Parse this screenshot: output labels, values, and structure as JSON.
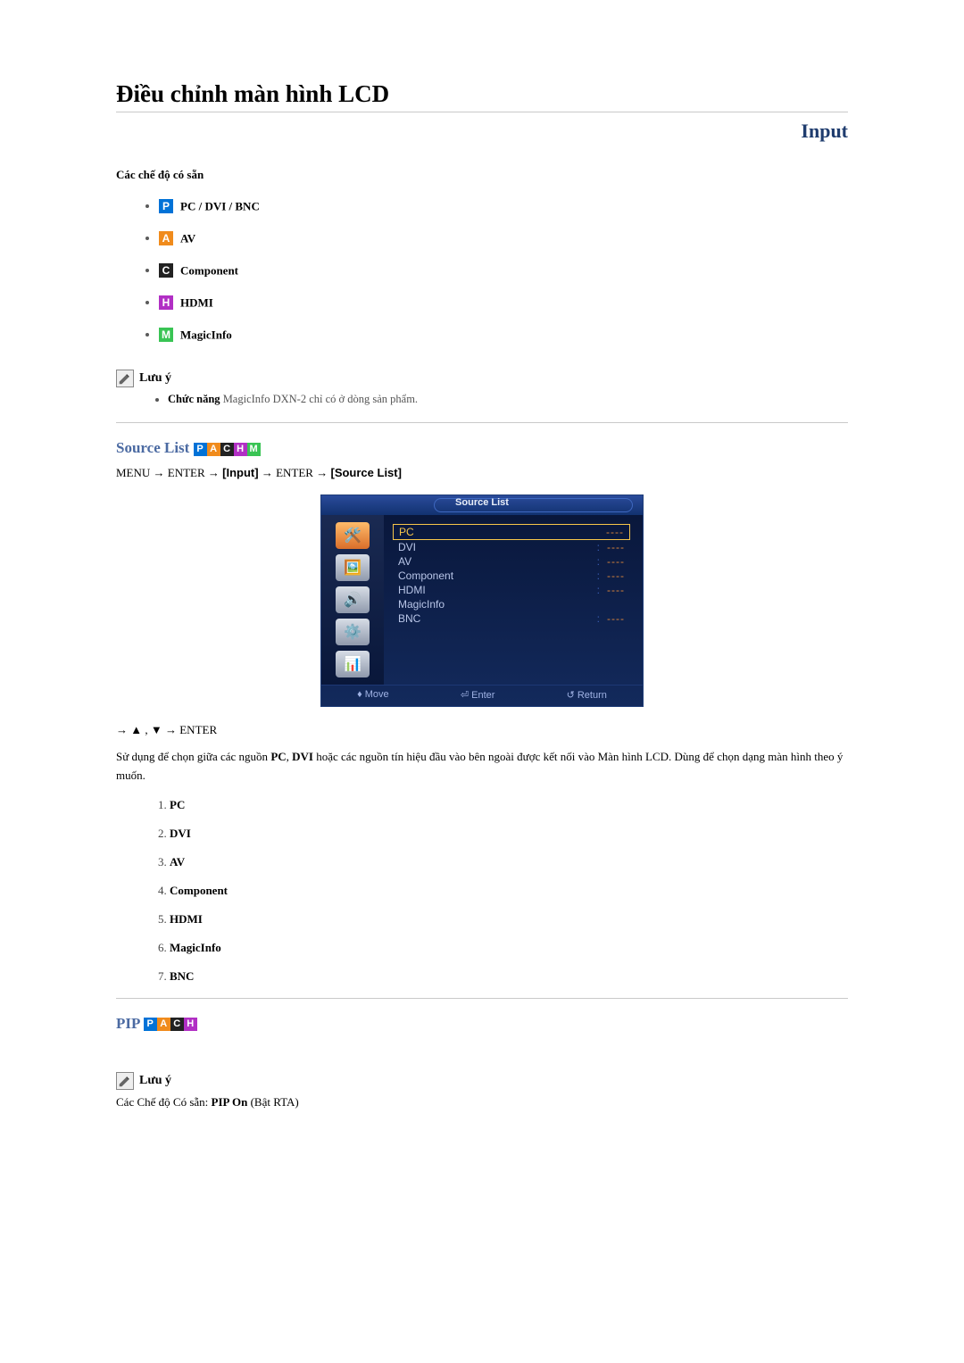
{
  "title": "Điều chỉnh màn hình LCD",
  "input_heading": "Input",
  "modes_title": "Các chế độ có sẵn",
  "modes": {
    "P": "PC / DVI / BNC",
    "A": "AV",
    "C": "Component",
    "H": "HDMI",
    "M": "MagicInfo"
  },
  "note_label": "Lưu ý",
  "note1_prefix": "Chức năng",
  "note1_rest": " MagicInfo DXN-2 chỉ có ở dòng sản phẩm.",
  "source_list_title": "Source List",
  "menu_path": {
    "p1": "MENU → ENTER → ",
    "osd1": "[Input]",
    "p2": " → ENTER → ",
    "osd2": "[Source List]"
  },
  "osd": {
    "title": "Source List",
    "rows": [
      {
        "label": "PC",
        "dash": "----",
        "sel": true,
        "sep": false
      },
      {
        "label": "DVI",
        "dash": "----",
        "sel": false,
        "sep": true
      },
      {
        "label": "AV",
        "dash": "----",
        "sel": false,
        "sep": true
      },
      {
        "label": "Component",
        "dash": "----",
        "sel": false,
        "sep": true
      },
      {
        "label": "HDMI",
        "dash": "----",
        "sel": false,
        "sep": true
      },
      {
        "label": "MagicInfo",
        "dash": "",
        "sel": false,
        "sep": false
      },
      {
        "label": "BNC",
        "dash": "----",
        "sel": false,
        "sep": true
      }
    ],
    "footer": {
      "move": "Move",
      "enter": "Enter",
      "return": "Return"
    }
  },
  "nav_instr": "→ ▲ , ▼ → ENTER",
  "para_prefix": "Sử dụng để chọn giữa các nguồn ",
  "para_pc": "PC",
  "para_sep": ", ",
  "para_dvi": "DVI",
  "para_rest": " hoặc các nguồn tín hiệu đầu vào bên ngoài được kết nối vào Màn hình LCD. Dùng để chọn dạng màn hình theo ý muốn.",
  "src_items": [
    "PC",
    "DVI",
    "AV",
    "Component",
    "HDMI",
    "MagicInfo",
    "BNC"
  ],
  "pip_title": "PIP",
  "pip_note_prefix": "Các Chế độ Có sẵn: ",
  "pip_note_bold": "PIP On",
  "pip_note_rest": " (Bật RTA)"
}
